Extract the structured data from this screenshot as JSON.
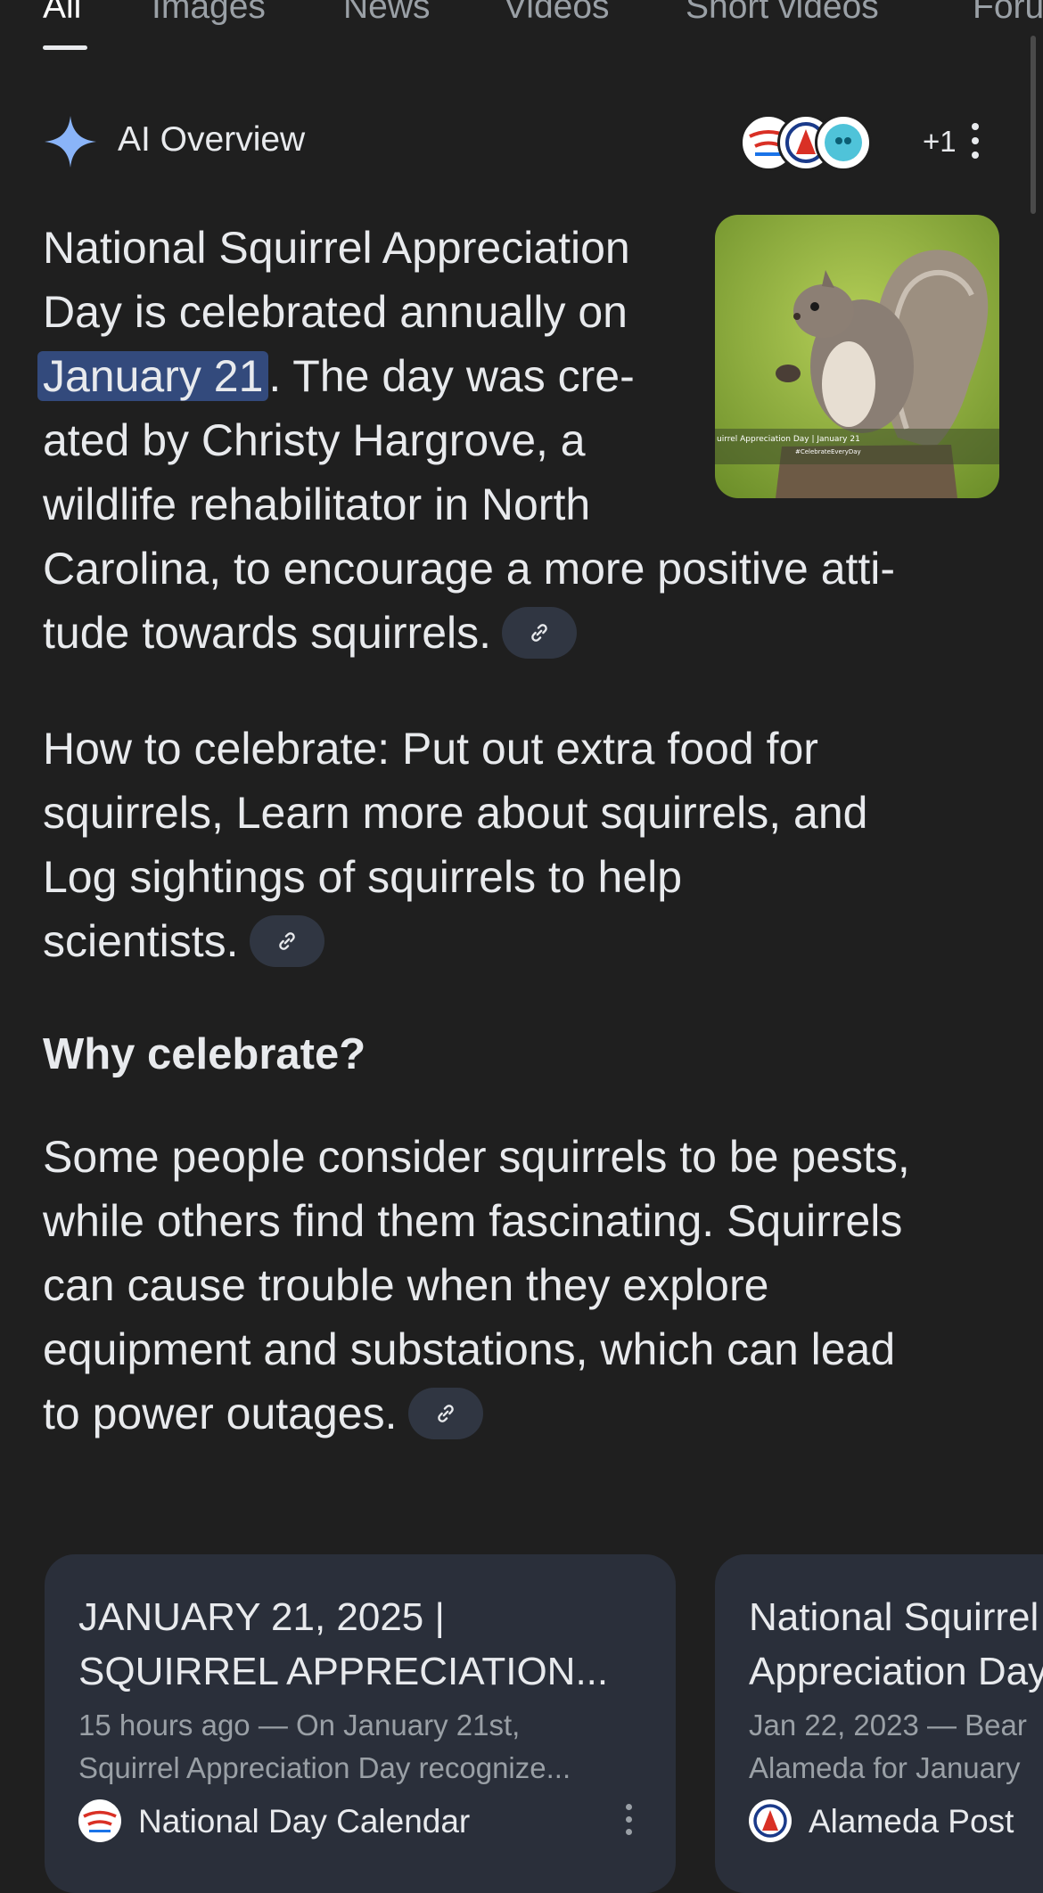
{
  "tabs": [
    {
      "label": "All",
      "active": true
    },
    {
      "label": "Images"
    },
    {
      "label": "News"
    },
    {
      "label": "Videos"
    },
    {
      "label": "Short videos"
    },
    {
      "label": "Forums"
    }
  ],
  "ai_overview": {
    "title": "AI Overview",
    "more_sources_count": "+1",
    "image_caption_line1": "uirrel Appreciation Day | January 21",
    "image_caption_line2": "#CelebrateEveryDay",
    "p1": {
      "line1": "National Squirrel Appreciation",
      "line2": "Day is celebrated annually on",
      "highlight": "January 21",
      "line3_rest": ". The day was cre-",
      "line4": "ated by Christy Hargrove, a",
      "line5": "wildlife rehabilitator in North",
      "line6": "Carolina, to encourage a more positive atti-",
      "line7": "tude towards squirrels."
    },
    "p2": {
      "line1": "How to celebrate: Put out extra food for",
      "line2": "squirrels, Learn more about squirrels, and",
      "line3": "Log sightings of squirrels to help",
      "line4": "scientists."
    },
    "heading": "Why celebrate?",
    "p3": {
      "line1": "Some people consider squirrels to be pests,",
      "line2": "while others find them fascinating. Squirrels",
      "line3": "can cause trouble when they explore",
      "line4": "equipment and substations, which can lead",
      "line5": "to power outages."
    }
  },
  "cards": [
    {
      "title_line1": "JANUARY 21, 2025 |",
      "title_line2": "SQUIRREL APPRECIATION...",
      "snippet_line1": "15 hours ago — On January 21st,",
      "snippet_line2": "Squirrel Appreciation Day recognize...",
      "source": "National Day Calendar"
    },
    {
      "title_line1": "National Squirrel",
      "title_line2": "Appreciation Day",
      "snippet_line1": "Jan 22, 2023 — Bear",
      "snippet_line2": "Alameda for January",
      "source": "Alameda Post"
    }
  ],
  "colors": {
    "background": "#1f1f1f",
    "highlight": "#334a7c",
    "card": "#2a2f3a",
    "sparkle": "#8ab4f8"
  }
}
